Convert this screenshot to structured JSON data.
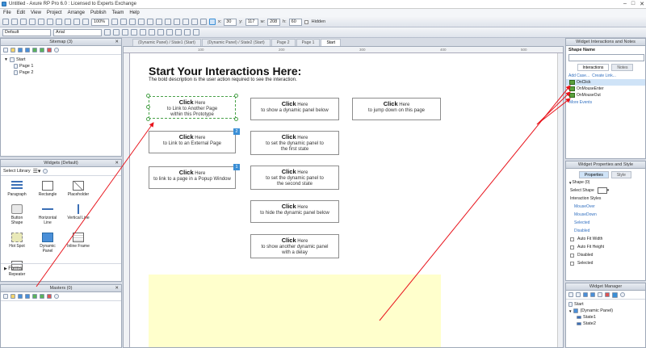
{
  "window": {
    "title": "Untitled - Axure RP Pro 6.0 : Licensed to Experts Exchange"
  },
  "menu": [
    "File",
    "Edit",
    "View",
    "Project",
    "Arrange",
    "Publish",
    "Team",
    "Help"
  ],
  "toolbar": {
    "zoom": "100%",
    "x_label": "x:",
    "x_value": "30",
    "y_label": "y:",
    "y_value": "117",
    "w_label": "w:",
    "w_value": "208",
    "h_label": "h:",
    "h_value": "60",
    "hidden_label": "Hidden",
    "style": "Default",
    "font": "Arial"
  },
  "sitemap": {
    "header": "Sitemap (3)",
    "items": [
      {
        "label": "Start"
      },
      {
        "label": "Page 1"
      },
      {
        "label": "Page 2"
      }
    ]
  },
  "widgets": {
    "header": "Widgets (Default)",
    "library": "Select Library",
    "items": [
      {
        "label": "Paragraph",
        "icon": "paragraph-icon"
      },
      {
        "label": "Rectangle",
        "icon": "rectangle-icon"
      },
      {
        "label": "Placeholder",
        "icon": "placeholder-icon"
      },
      {
        "label": "Button Shape",
        "icon": "button-shape-icon"
      },
      {
        "label": "Horizontal Line",
        "icon": "horizontal-line-icon"
      },
      {
        "label": "Vertical Line",
        "icon": "vertical-line-icon"
      },
      {
        "label": "Hot Spot",
        "icon": "hot-spot-icon"
      },
      {
        "label": "Dynamic Panel",
        "icon": "dynamic-panel-icon"
      },
      {
        "label": "Inline Frame",
        "icon": "inline-frame-icon"
      },
      {
        "label": "Repeater",
        "icon": "repeater-icon"
      }
    ],
    "section": "Forms"
  },
  "masters": {
    "header": "Masters (0)"
  },
  "tabs": [
    {
      "label": "(Dynamic Panel) / State1 (Start)",
      "active": false
    },
    {
      "label": "(Dynamic Panel) / State2 (Start)",
      "active": false
    },
    {
      "label": "Page 2",
      "active": false
    },
    {
      "label": "Page 1",
      "active": false
    },
    {
      "label": "Start",
      "active": true
    }
  ],
  "canvas": {
    "heading": "Start Your Interactions Here:",
    "description": "The bold description is the user action required to see the interaction.",
    "buttons": [
      {
        "bold": "Click",
        "rest": " Here",
        "line2": "to Link to Another Page",
        "line3": "within this Prototype"
      },
      {
        "bold": "Click",
        "rest": " Here",
        "line2": "to Link to an External Page",
        "line3": ""
      },
      {
        "bold": "Click",
        "rest": " Here",
        "line2": "to link to a page in a Popup Window",
        "line3": ""
      },
      {
        "bold": "Click",
        "rest": " Here",
        "line2": "to show a dynamic panel below",
        "line3": ""
      },
      {
        "bold": "Click",
        "rest": " Here",
        "line2": "to set the dynamic panel to",
        "line3": "the first state"
      },
      {
        "bold": "Click",
        "rest": " Here",
        "line2": "to set the dynamic panel to",
        "line3": "the second state"
      },
      {
        "bold": "Click",
        "rest": " Here",
        "line2": "to hide the dynamic panel below",
        "line3": ""
      },
      {
        "bold": "Click",
        "rest": " Here",
        "line2": "to show another dynamic panel",
        "line3": "with a delay"
      },
      {
        "bold": "Click",
        "rest": " Here",
        "line2": "to jump down on this page",
        "line3": ""
      }
    ],
    "badges": [
      "2",
      "1"
    ],
    "ruler_numbers": [
      "100",
      "200",
      "300",
      "400",
      "500",
      "600",
      "700",
      "800"
    ]
  },
  "interactions": {
    "header": "Widget Interactions and Notes",
    "shape_name_label": "Shape Name",
    "tab_interactions": "Interactions",
    "tab_notes": "Notes",
    "add_case": "Add Case...",
    "create_link": "Create Link...",
    "events": [
      "OnClick",
      "OnMouseEnter",
      "OnMouseOut"
    ],
    "more_events": "More Events"
  },
  "properties": {
    "header": "Widget Properties and Style",
    "tab_properties": "Properties",
    "tab_style": "Style",
    "shape_header": "Shape (0)",
    "select_shape": "Select Shape",
    "interaction_styles": "Interaction Styles",
    "links": [
      "MouseOver",
      "MouseDown",
      "Selected",
      "Disabled"
    ],
    "checks": [
      "Auto Fit Width",
      "Auto Fit Height",
      "Disabled",
      "Selected"
    ]
  },
  "manager": {
    "header": "Widget Manager",
    "items": [
      {
        "label": "Start"
      },
      {
        "label": "(Dynamic Panel)"
      },
      {
        "label": "State1"
      },
      {
        "label": "State2"
      }
    ]
  },
  "colors": {
    "accent": "#3b8fd6",
    "yellow_panel": "#ffffcc",
    "arrow": "#e8141c",
    "selection": "#4aa24a"
  }
}
